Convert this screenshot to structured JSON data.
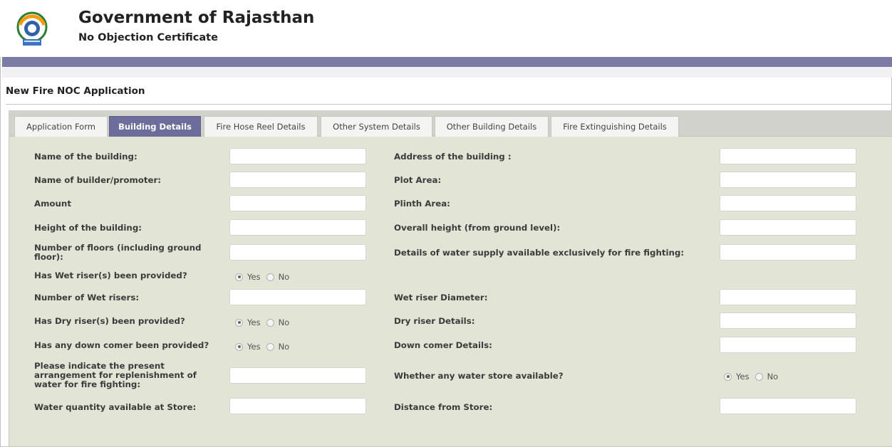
{
  "header": {
    "title": "Government of Rajasthan",
    "subtitle": "No Objection Certificate",
    "logo_icon": "rajasthan-emblem-logo"
  },
  "page": {
    "title": "New Fire NOC Application"
  },
  "tabs": [
    {
      "label": "Application Form",
      "active": false
    },
    {
      "label": "Building Details",
      "active": true
    },
    {
      "label": "Fire Hose Reel Details",
      "active": false
    },
    {
      "label": "Other System Details",
      "active": false
    },
    {
      "label": "Other Building Details",
      "active": false
    },
    {
      "label": "Fire Extinguishing Details",
      "active": false
    }
  ],
  "form": {
    "building_name_label": "Name of the building:",
    "building_address_label": "Address of the building :",
    "builder_name_label": "Name of builder/promoter:",
    "plot_area_label": "Plot Area:",
    "amount_label": "Amount",
    "plinth_area_label": "Plinth Area:",
    "building_height_label": "Height of the building:",
    "overall_height_label": "Overall height (from ground level):",
    "floors_label": "Number of floors (including ground floor):",
    "water_supply_label": "Details of water supply available exclusively for fire fighting:",
    "wet_riser_label": "Has Wet riser(s) been provided?",
    "wet_riser_count_label": "Number of Wet risers:",
    "wet_riser_diameter_label": "Wet riser Diameter:",
    "dry_riser_label": "Has Dry riser(s) been provided?",
    "dry_riser_details_label": "Dry riser Details:",
    "down_comer_label": "Has any down comer been provided?",
    "down_comer_details_label": "Down comer Details:",
    "replenishment_label": "Please indicate the present arrangement for replenishment of water for fire fighting:",
    "water_store_label": "Whether any water store available?",
    "water_quantity_label": "Water quantity available at Store:",
    "store_distance_label": "Distance from Store:",
    "yes_label": "Yes",
    "no_label": "No",
    "wet_riser_selected": "Yes",
    "dry_riser_selected": "Yes",
    "down_comer_selected": "Yes",
    "water_store_selected": "Yes"
  },
  "colors": {
    "accent_bar": "#7b7ba6",
    "active_tab": "#6d6d9c",
    "panel_background": "#e2e4d6"
  }
}
